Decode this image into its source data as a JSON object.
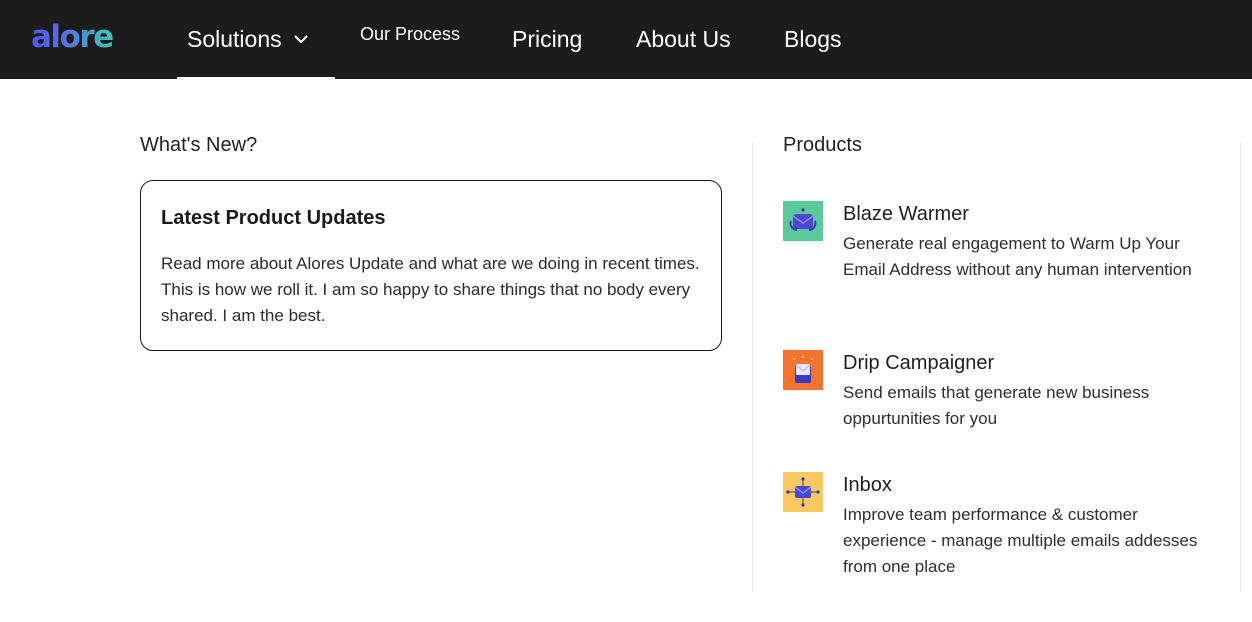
{
  "brand": {
    "logo_text": "alore"
  },
  "nav": {
    "items": [
      {
        "label": "Solutions",
        "active": true,
        "has_dropdown": true
      },
      {
        "label": "Our Process"
      },
      {
        "label": "Pricing"
      },
      {
        "label": "About Us"
      },
      {
        "label": "Blogs"
      }
    ]
  },
  "whats_new": {
    "title": "What's New?",
    "card": {
      "title": "Latest Product Updates",
      "body": "Read more about Alores Update and what are we doing in recent times. This is how we roll it. I am so happy to share things that no body every shared. I am the best."
    }
  },
  "products": {
    "title": "Products",
    "items": [
      {
        "name": "Blaze Warmer",
        "description": "Generate real engagement to Warm Up Your Email Address without any human intervention",
        "icon": "envelope-fire-icon",
        "icon_bg": "#5cc99b"
      },
      {
        "name": "Drip Campaigner",
        "description": "Send emails that generate new business oppurtunities for you",
        "icon": "drip-envelope-icon",
        "icon_bg": "#f4742f"
      },
      {
        "name": "Inbox",
        "description": "Improve team performance & customer experience - manage multiple emails addesses from one place",
        "icon": "inbox-network-icon",
        "icon_bg": "#f7c95e"
      }
    ]
  },
  "colors": {
    "nav_bg": "#1c1c1c",
    "logo_gradient_start": "#4f57e8",
    "logo_gradient_end": "#38c9b0"
  }
}
